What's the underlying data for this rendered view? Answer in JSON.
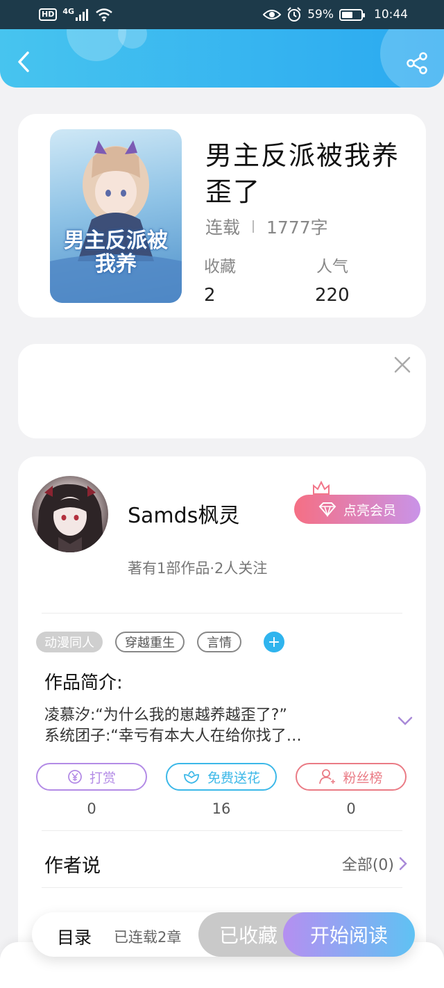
{
  "status_bar": {
    "hd": "HD",
    "network": "4G",
    "battery_percent": "59%",
    "battery_level": 0.59,
    "time": "10:44"
  },
  "header": {
    "back_icon": "chevron-left-icon",
    "share_icon": "share-icon",
    "gradient": [
      "#47c4ef",
      "#2aa9f0"
    ]
  },
  "book": {
    "title": "男主反派被我养歪了",
    "cover_title": "男主反派被我养",
    "status": "连载",
    "word_count": "1777字",
    "stats": [
      {
        "label": "收藏",
        "value": "2"
      },
      {
        "label": "人气",
        "value": "220"
      }
    ]
  },
  "author": {
    "name": "Samds枫灵",
    "vip_button": "点亮会员",
    "summary": "著有1部作品·2人关注"
  },
  "tags": [
    "动漫同人",
    "穿越重生",
    "言情"
  ],
  "intro": {
    "title": "作品简介:",
    "line1": "凌慕汐:“为什么我的崽越养越歪了?”",
    "line2": "系统团子:“幸亏有本大人在给你找了…"
  },
  "actions": [
    {
      "label": "打赏",
      "count": "0",
      "color": "#b38be6",
      "icon": "yuan-coin-icon"
    },
    {
      "label": "免费送花",
      "count": "16",
      "color": "#3cb8e8",
      "icon": "flower-icon"
    },
    {
      "label": "粉丝榜",
      "count": "0",
      "color": "#ea7b85",
      "icon": "user-icon"
    }
  ],
  "author_says": {
    "title": "作者说",
    "all_link": "全部(0)"
  },
  "bottom": {
    "toc": "目录",
    "serial": "已连载2章",
    "collected": "已收藏",
    "start_reading": "开始阅读"
  }
}
